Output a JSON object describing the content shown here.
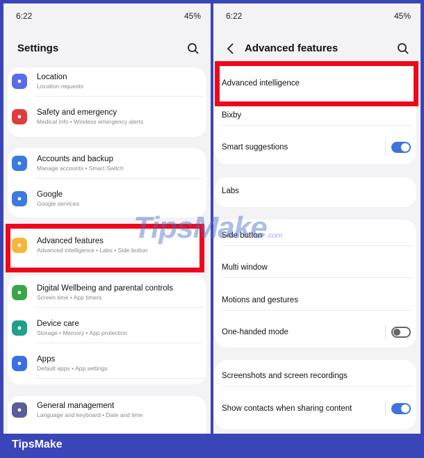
{
  "status": {
    "time": "6:22",
    "battery": "45%"
  },
  "left": {
    "title": "Settings",
    "items": [
      {
        "label": "Location",
        "sub": "Location requests",
        "icon": "location-pin-icon",
        "color": "#5a6be8"
      },
      {
        "label": "Safety and emergency",
        "sub": "Medical info  •  Wireless emergency alerts",
        "icon": "alert-icon",
        "color": "#e03c3c"
      },
      {
        "label": "Accounts and backup",
        "sub": "Manage accounts  •  Smart Switch",
        "icon": "sync-icon",
        "color": "#3b7be0"
      },
      {
        "label": "Google",
        "sub": "Google services",
        "icon": "google-icon",
        "color": "#3b7be0"
      },
      {
        "label": "Advanced features",
        "sub": "Advanced intelligence  •  Labs  •  Side button",
        "icon": "gear-plus-icon",
        "color": "#f4b73a"
      },
      {
        "label": "Digital Wellbeing and parental controls",
        "sub": "Screen time  •  App timers",
        "icon": "wellbeing-icon",
        "color": "#3aa64a"
      },
      {
        "label": "Device care",
        "sub": "Storage  •  Memory  •  App protection",
        "icon": "device-care-icon",
        "color": "#1fa08a"
      },
      {
        "label": "Apps",
        "sub": "Default apps  •  App settings",
        "icon": "apps-grid-icon",
        "color": "#3b6fe8"
      },
      {
        "label": "General management",
        "sub": "Language and keyboard  •  Date and time",
        "icon": "sliders-icon",
        "color": "#5a5c9c"
      }
    ]
  },
  "right": {
    "title": "Advanced features",
    "items": [
      {
        "label": "Advanced intelligence"
      },
      {
        "label": "Bixby"
      },
      {
        "label": "Smart suggestions",
        "toggle": true
      },
      {
        "label": "Labs"
      },
      {
        "label": "Side button"
      },
      {
        "label": "Multi window"
      },
      {
        "label": "Motions and gestures"
      },
      {
        "label": "One-handed mode",
        "toggle": false
      },
      {
        "label": "Screenshots and screen recordings"
      },
      {
        "label": "Show contacts when sharing content",
        "toggle": true
      }
    ]
  },
  "watermark": "TipsMake",
  "watermark_suffix": ".com",
  "brand": "TipsMake",
  "colors": {
    "highlight": "#f0061c",
    "frame": "#3a45b8",
    "toggle_on": "#3e73e0"
  }
}
